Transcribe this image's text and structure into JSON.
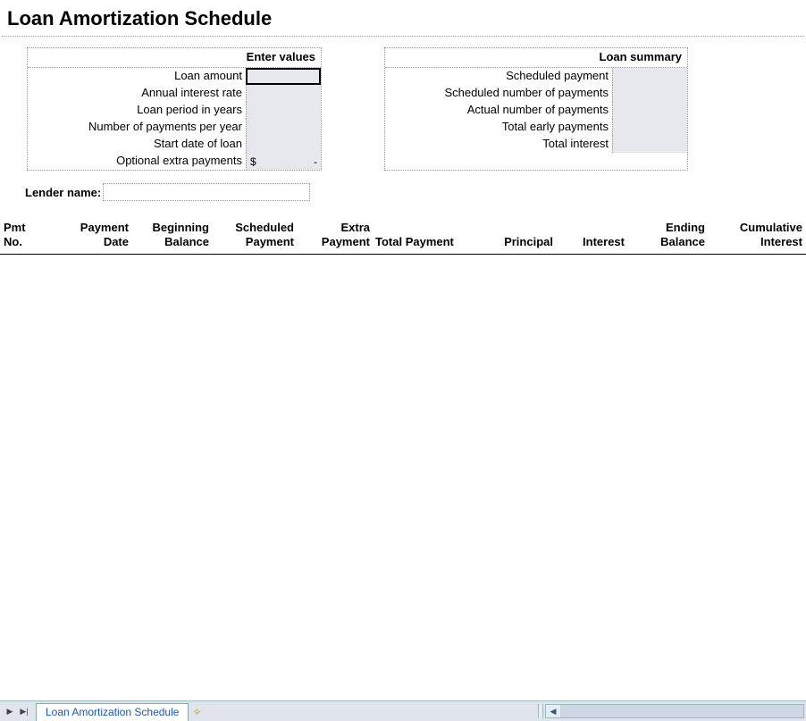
{
  "title": "Loan Amortization Schedule",
  "enter_values": {
    "header": "Enter values",
    "rows": {
      "loan_amount": {
        "label": "Loan amount",
        "value": ""
      },
      "annual_rate": {
        "label": "Annual interest rate",
        "value": ""
      },
      "loan_period": {
        "label": "Loan period in years",
        "value": ""
      },
      "num_payments": {
        "label": "Number of payments per year",
        "value": ""
      },
      "start_date": {
        "label": "Start date of loan",
        "value": ""
      },
      "extra_payments": {
        "label": "Optional extra payments",
        "currency": "$",
        "value": "-"
      }
    }
  },
  "loan_summary": {
    "header": "Loan summary",
    "rows": {
      "scheduled_payment": {
        "label": "Scheduled payment",
        "value": ""
      },
      "scheduled_num": {
        "label": "Scheduled number of payments",
        "value": ""
      },
      "actual_num": {
        "label": "Actual number of payments",
        "value": ""
      },
      "total_early": {
        "label": "Total early payments",
        "value": ""
      },
      "total_interest": {
        "label": "Total interest",
        "value": ""
      }
    }
  },
  "lender": {
    "label": "Lender name:",
    "value": ""
  },
  "table_headers": {
    "pmt_no": [
      "Pmt",
      "No."
    ],
    "payment_date": [
      "Payment",
      "Date"
    ],
    "beginning_balance": [
      "Beginning",
      "Balance"
    ],
    "scheduled_payment": [
      "Scheduled",
      "Payment"
    ],
    "extra_payment": [
      "Extra",
      "Payment"
    ],
    "total_payment": "Total Payment",
    "principal": "Principal",
    "interest": "Interest",
    "ending_balance": [
      "Ending",
      "Balance"
    ],
    "cumulative_interest": [
      "Cumulative",
      "Interest"
    ]
  },
  "sheet_tab": "Loan Amortization Schedule"
}
